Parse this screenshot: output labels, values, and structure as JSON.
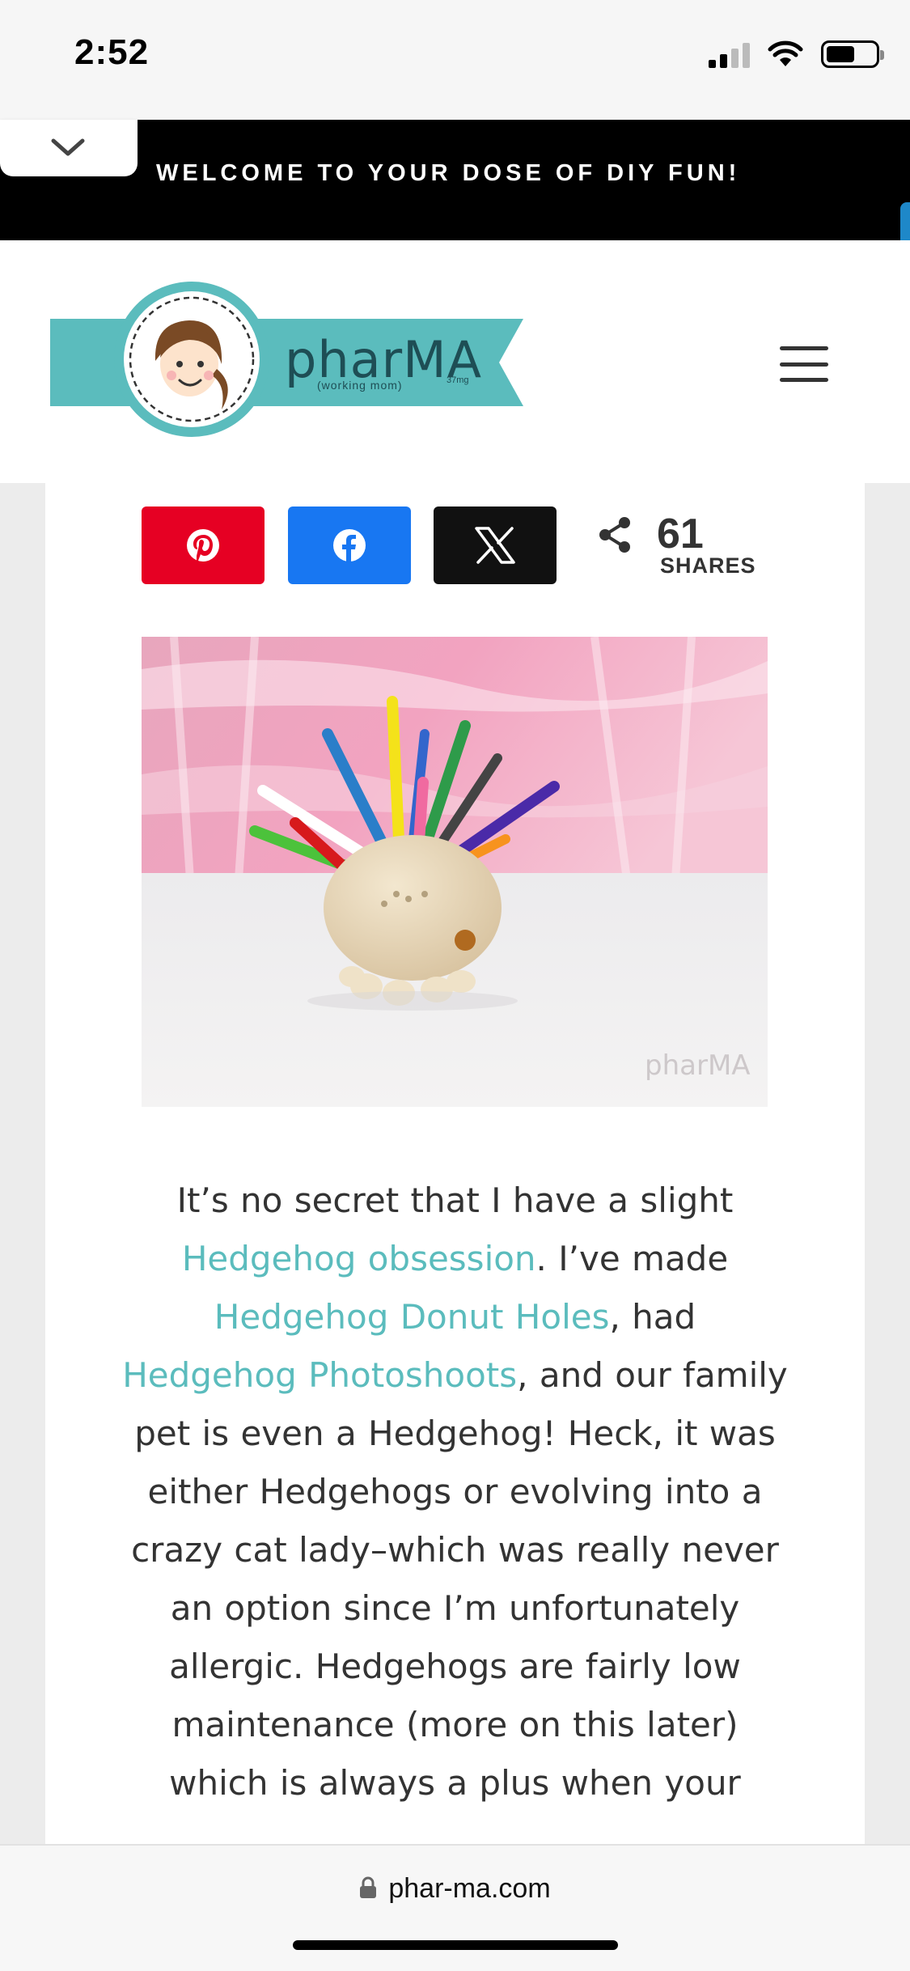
{
  "status_bar": {
    "time": "2:52"
  },
  "banner": {
    "text": "WELCOME TO YOUR DOSE OF DIY FUN!"
  },
  "header": {
    "logo_text": "pharMA",
    "logo_subtext": "(working mom)",
    "logo_dose": "37mg"
  },
  "share": {
    "buttons": [
      {
        "network": "pinterest",
        "icon": "pinterest-icon",
        "color": "#e60023"
      },
      {
        "network": "facebook",
        "icon": "facebook-icon",
        "color": "#1877f2"
      },
      {
        "network": "x",
        "icon": "x-icon",
        "color": "#111111"
      }
    ],
    "count": "61",
    "label": "SHARES"
  },
  "hero_image": {
    "watermark": "pharMA"
  },
  "article": {
    "p1": "It’s no secret that I have a slight ",
    "link1": "Hedgehog obsession",
    "p2": ". I’ve made ",
    "link2": "Hedgehog Donut Holes",
    "p3": ", had ",
    "link3": "Hedgehog Photoshoots",
    "p4": ", and our family pet is even a Hedgehog! Heck, it was either Hedgehogs or evolving into a crazy cat lady–which was really never an option since I’m unfortunately allergic. Hedgehogs are fairly low maintenance (more on this later) which is always a plus when your"
  },
  "browser": {
    "url": "phar-ma.com"
  },
  "colors": {
    "teal": "#5bbcbd",
    "banner_bg": "#000000",
    "link": "#5bbcbd"
  }
}
